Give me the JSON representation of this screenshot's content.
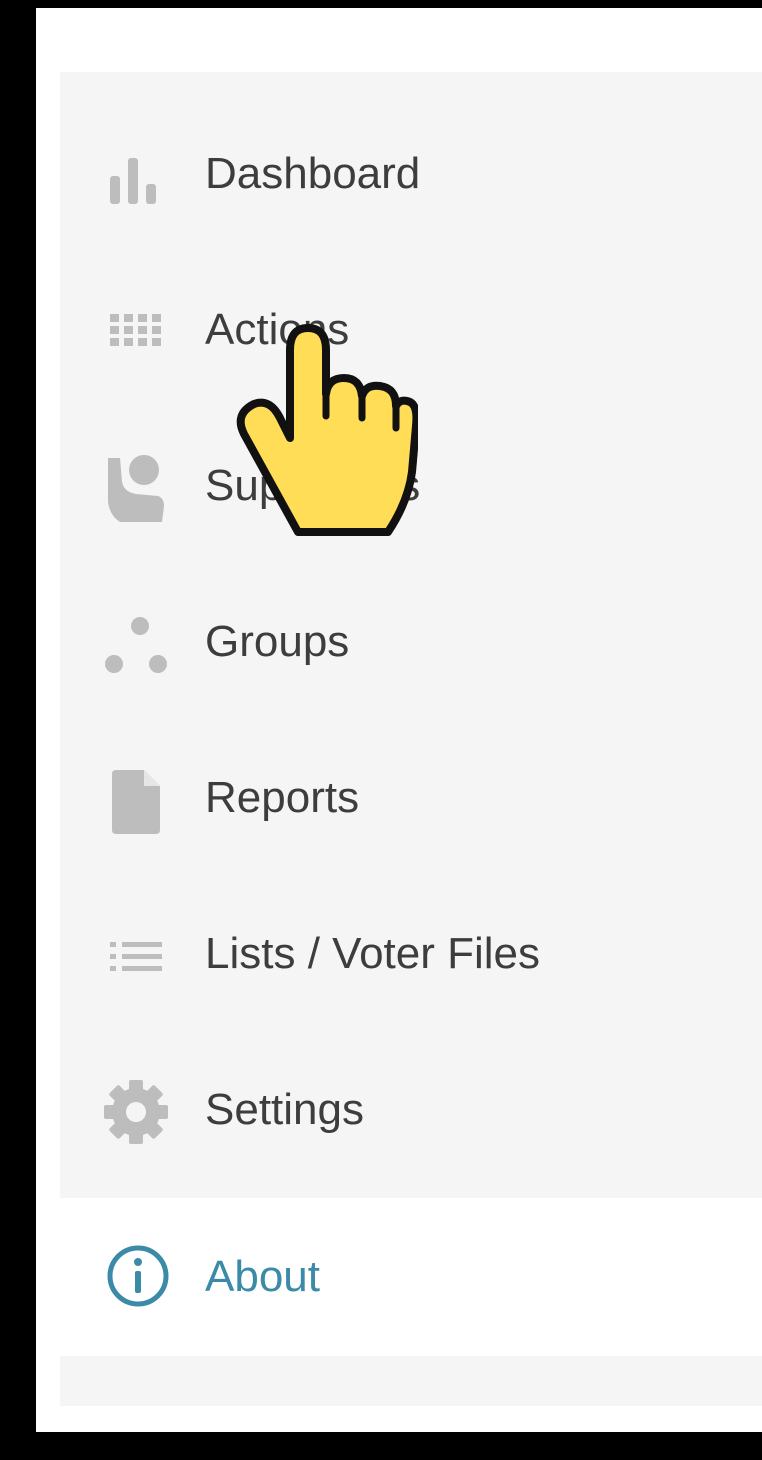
{
  "nav": {
    "items": [
      {
        "label": "Dashboard",
        "icon": "bar-chart-icon"
      },
      {
        "label": "Actions",
        "icon": "grid-icon"
      },
      {
        "label": "Supporters",
        "icon": "supporter-icon"
      },
      {
        "label": "Groups",
        "icon": "groups-dots-icon"
      },
      {
        "label": "Reports",
        "icon": "document-icon"
      },
      {
        "label": "Lists / Voter Files",
        "icon": "list-icon"
      },
      {
        "label": "Settings",
        "icon": "gear-icon"
      }
    ],
    "about": {
      "label": "About",
      "icon": "info-icon"
    }
  },
  "colors": {
    "panel_bg": "#f5f5f5",
    "icon_gray": "#bdbdbd",
    "text": "#3d3d3d",
    "about_accent": "#3a8aa8",
    "cursor_fill": "#ffdd57"
  },
  "cursor": {
    "icon": "pointing-hand-cursor-icon"
  }
}
